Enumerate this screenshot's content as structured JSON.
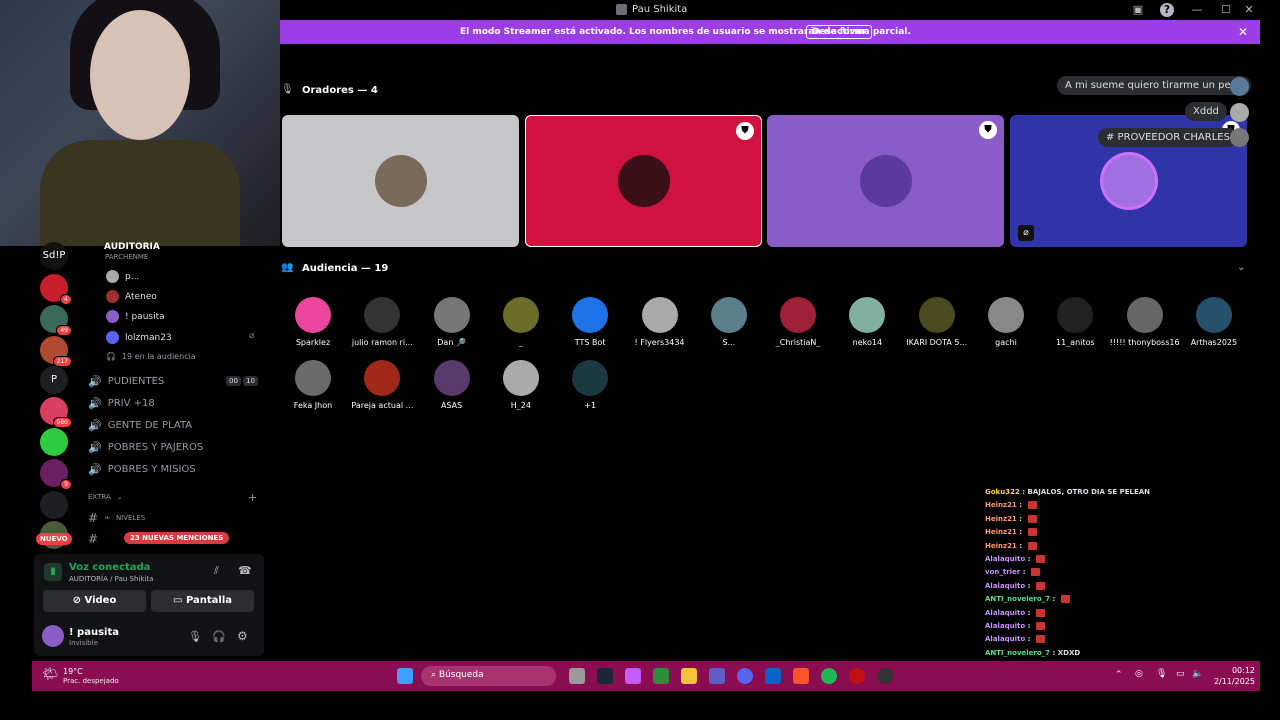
{
  "window": {
    "title": "Pau Shikita"
  },
  "banner": {
    "message": "El modo Streamer está activado. Los nombres de usuario se mostrarán de forma parcial.",
    "button": "Desactivar"
  },
  "servers": [
    {
      "label": "Sd!P"
    },
    {
      "label": "",
      "badge": "4"
    },
    {
      "label": "",
      "badge": "49"
    },
    {
      "label": "",
      "badge": "217"
    },
    {
      "label": "P"
    },
    {
      "label": "",
      "badge": "980"
    },
    {
      "label": ""
    },
    {
      "label": "",
      "badge": "9"
    },
    {
      "label": ""
    },
    {
      "label": ""
    }
  ],
  "new_label": "NUEVO",
  "channels": {
    "stage_name": "AUDITORIA",
    "stage_topic": "PARCHENME",
    "stage_users": [
      "p...",
      "Ateneo",
      "! pausita",
      "lolzman23"
    ],
    "audience_count": "19 en la audiencia",
    "voice": [
      {
        "name": "PUDIENTES",
        "c1": "00",
        "c2": "10"
      },
      {
        "name": "PRIV +18"
      },
      {
        "name": "GENTE DE PLATA"
      },
      {
        "name": "POBRES Y PAJEROS"
      },
      {
        "name": "POBRES Y MISIOS"
      }
    ],
    "category": "EXTRA",
    "text": [
      "NIVELES"
    ],
    "mentions": "23 NUEVAS MENCIONES"
  },
  "voice_panel": {
    "status": "Voz conectada",
    "sub": "AUDITORÍA / Pau Shikita",
    "video": "Video",
    "screen": "Pantalla"
  },
  "user": {
    "name": "! pausita",
    "status": "Invisible"
  },
  "stage": {
    "speakers_title": "Oradores — 4",
    "speakers": [
      {
        "color": "#c7c7c9",
        "mod": false
      },
      {
        "color": "#d0123e",
        "mod": true
      },
      {
        "color": "#8a5cc8",
        "mod": true
      },
      {
        "color": "#2f35a8",
        "mod": true,
        "muted": true
      }
    ],
    "audience_title": "Audiencia — 19",
    "audience": [
      {
        "name": "Sparklez",
        "c": "#eb459e"
      },
      {
        "name": "julio ramon ri...",
        "c": "#333"
      },
      {
        "name": "Dan 🔎",
        "c": "#777"
      },
      {
        "name": "_",
        "c": "#6b6b2a"
      },
      {
        "name": "TTS Bot",
        "c": "#1e73e8"
      },
      {
        "name": "! Flyers3434",
        "c": "#aaa"
      },
      {
        "name": "S...",
        "c": "#5a7f8a"
      },
      {
        "name": "_ChristiaN_",
        "c": "#a0203a"
      },
      {
        "name": "neko14",
        "c": "#7fb0a0"
      },
      {
        "name": "IKARI DOTA 5...",
        "c": "#4a4a20"
      },
      {
        "name": "gachi",
        "c": "#888"
      },
      {
        "name": "11_anitos",
        "c": "#222"
      },
      {
        "name": "!!!!! thonyboss16",
        "c": "#666"
      },
      {
        "name": "Arthas2025",
        "c": "#24506a"
      },
      {
        "name": "Feka Jhon",
        "c": "#6a6a6a"
      },
      {
        "name": "Pareja actual ...",
        "c": "#a02818"
      },
      {
        "name": "ASAS",
        "c": "#5a3a6a"
      },
      {
        "name": "H_24",
        "c": "#aaa"
      },
      {
        "name": "+1",
        "c": "#1a3a40"
      }
    ]
  },
  "floating": [
    "A mi sueme quiero tirarme un pedo",
    "Xddd",
    "# PROVEEDOR CHARLES"
  ],
  "chat": [
    {
      "user": "Goku322",
      "msg": "BAJALOS, OTRO DIA SE PELEAN",
      "color": "#ffd23f"
    },
    {
      "user": "Heinz21",
      "msg": "",
      "color": "#ff9a6a"
    },
    {
      "user": "Heinz21",
      "msg": "",
      "color": "#ff9a6a"
    },
    {
      "user": "Heinz21",
      "msg": "",
      "color": "#ff9a6a"
    },
    {
      "user": "Heinz21",
      "msg": "",
      "color": "#ff9a6a"
    },
    {
      "user": "Alalaquito",
      "msg": "",
      "color": "#c792ff"
    },
    {
      "user": "von_trier",
      "msg": "",
      "color": "#c792ff"
    },
    {
      "user": "Alalaquito",
      "msg": "",
      "color": "#c792ff"
    },
    {
      "user": "ANTI_novelero_7",
      "msg": "",
      "color": "#4fe08a"
    },
    {
      "user": "Alalaquito",
      "msg": "",
      "color": "#c792ff"
    },
    {
      "user": "Alalaquito",
      "msg": "",
      "color": "#c792ff"
    },
    {
      "user": "Alalaquito",
      "msg": "",
      "color": "#c792ff"
    },
    {
      "user": "ANTI_novelero_7",
      "msg": "XDXD",
      "color": "#4fe08a"
    }
  ],
  "taskbar": {
    "temp": "19°C",
    "weather": "Prac. despejado",
    "search": "Búsqueda",
    "time": "00:12",
    "date": "2/11/2025"
  }
}
